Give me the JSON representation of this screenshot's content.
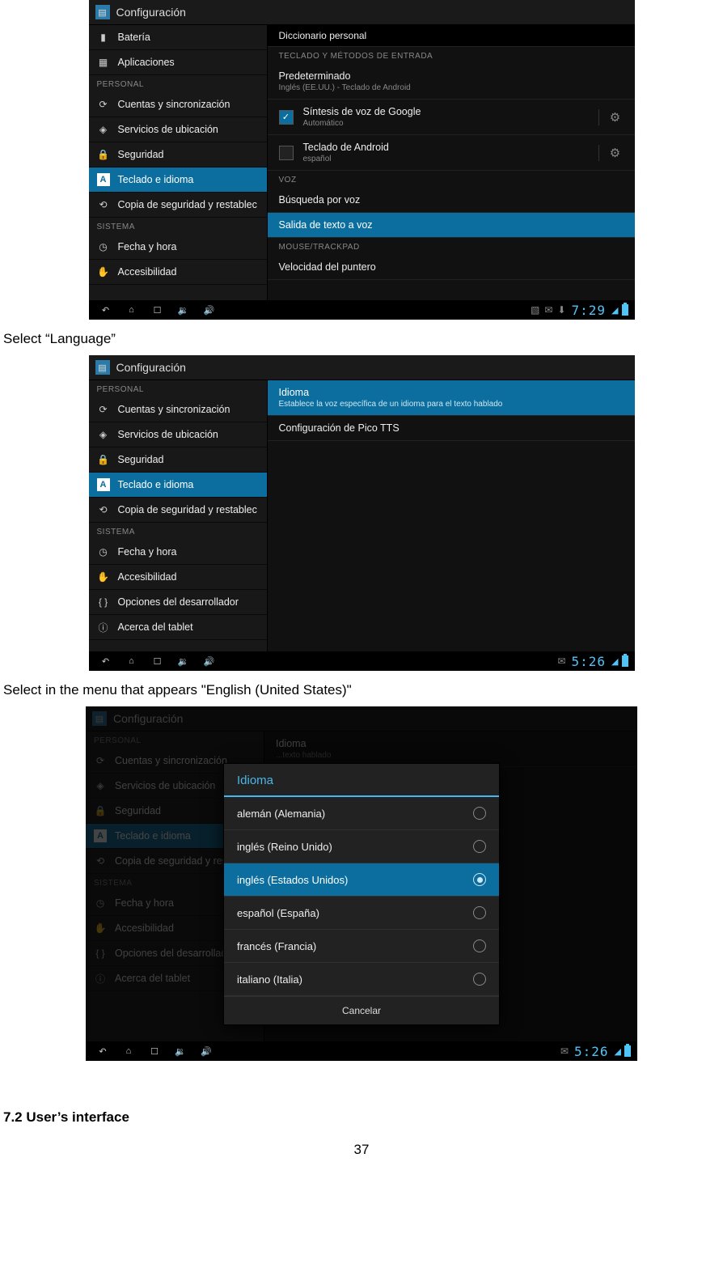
{
  "captions": {
    "select_language": "Select “Language”",
    "select_english": "Select in the menu that appears \"English (United States)\"",
    "section": "7.2 User’s interface",
    "page_number": "37"
  },
  "common": {
    "title": "Configuración",
    "sidebar_categories": {
      "personal": "PERSONAL",
      "sistema": "SISTEMA"
    },
    "sidebar": {
      "bateria": "Batería",
      "aplicaciones": "Aplicaciones",
      "cuentas": "Cuentas y sincronización",
      "ubicacion": "Servicios de ubicación",
      "seguridad": "Seguridad",
      "teclado": "Teclado e idioma",
      "copia": "Copia de seguridad y restablec",
      "fecha": "Fecha y hora",
      "accesibilidad": "Accesibilidad",
      "desarrollador": "Opciones del desarrollador",
      "acerca": "Acerca del tablet"
    }
  },
  "ss1": {
    "top_partial": "Diccionario personal",
    "headers": {
      "teclado": "TECLADO Y MÉTODOS DE ENTRADA",
      "voz": "VOZ",
      "mouse": "MOUSE/TRACKPAD"
    },
    "rows": {
      "predet": {
        "t": "Predeterminado",
        "s": "Inglés (EE.UU.) - Teclado de Android"
      },
      "sintesis": {
        "t": "Síntesis de voz de Google",
        "s": "Automático"
      },
      "teclado_android": {
        "t": "Teclado de Android",
        "s": "español"
      },
      "busqueda": "Búsqueda por voz",
      "salida": "Salida de texto a voz",
      "velocidad": "Velocidad del puntero"
    },
    "time": "7:29"
  },
  "ss2": {
    "rows": {
      "idioma": {
        "t": "Idioma",
        "s": "Establece la voz específica de un idioma para el texto hablado"
      },
      "pico": "Configuración de Pico TTS"
    },
    "time": "5:26"
  },
  "ss3": {
    "dialog_title": "Idioma",
    "options": {
      "de": "alemán (Alemania)",
      "en_uk": "inglés (Reino Unido)",
      "en_us": "inglés (Estados Unidos)",
      "es": "español (España)",
      "fr": "francés (Francia)",
      "it": "italiano (Italia)"
    },
    "cancel": "Cancelar",
    "bg_idioma": "Idioma",
    "bg_idioma_sub": "...texto hablado",
    "time": "5:26"
  }
}
